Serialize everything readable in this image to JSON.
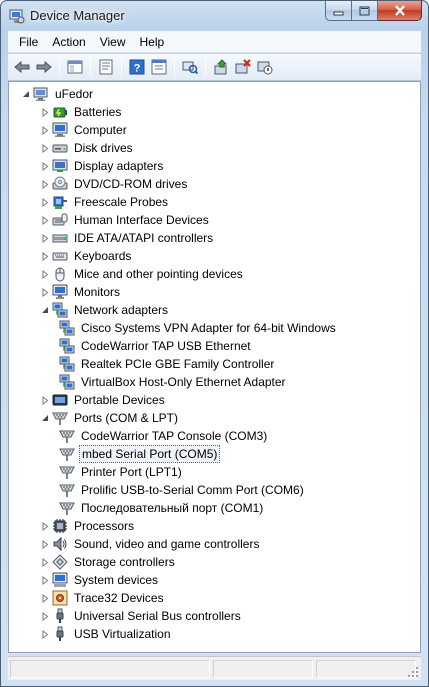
{
  "window": {
    "title": "Device Manager"
  },
  "menubar": {
    "items": [
      {
        "label": "File"
      },
      {
        "label": "Action"
      },
      {
        "label": "View"
      },
      {
        "label": "Help"
      }
    ]
  },
  "toolbar": {
    "buttons": [
      "back-icon",
      "forward-icon",
      "sep",
      "show-hide-console-tree-icon",
      "sep",
      "properties-icon",
      "sep",
      "help-icon",
      "properties-sheet-icon",
      "sep",
      "scan-hardware-icon",
      "sep",
      "update-driver-icon",
      "uninstall-icon",
      "disable-icon"
    ]
  },
  "tree": {
    "root": "uFedor",
    "nodes": [
      {
        "label": "Batteries",
        "level": 1,
        "expanded": false,
        "icon": "battery-icon"
      },
      {
        "label": "Computer",
        "level": 1,
        "expanded": false,
        "icon": "computer-icon"
      },
      {
        "label": "Disk drives",
        "level": 1,
        "expanded": false,
        "icon": "disk-drive-icon"
      },
      {
        "label": "Display adapters",
        "level": 1,
        "expanded": false,
        "icon": "display-adapter-icon"
      },
      {
        "label": "DVD/CD-ROM drives",
        "level": 1,
        "expanded": false,
        "icon": "dvd-drive-icon"
      },
      {
        "label": "Freescale Probes",
        "level": 1,
        "expanded": false,
        "icon": "probe-icon"
      },
      {
        "label": "Human Interface Devices",
        "level": 1,
        "expanded": false,
        "icon": "hid-icon"
      },
      {
        "label": "IDE ATA/ATAPI controllers",
        "level": 1,
        "expanded": false,
        "icon": "ide-controller-icon"
      },
      {
        "label": "Keyboards",
        "level": 1,
        "expanded": false,
        "icon": "keyboard-icon"
      },
      {
        "label": "Mice and other pointing devices",
        "level": 1,
        "expanded": false,
        "icon": "mouse-icon"
      },
      {
        "label": "Monitors",
        "level": 1,
        "expanded": false,
        "icon": "monitor-icon"
      },
      {
        "label": "Network adapters",
        "level": 1,
        "expanded": true,
        "icon": "network-adapter-icon"
      },
      {
        "label": "Cisco Systems VPN Adapter for 64-bit Windows",
        "level": 2,
        "icon": "network-adapter-icon"
      },
      {
        "label": "CodeWarrior TAP USB Ethernet",
        "level": 2,
        "icon": "network-adapter-icon"
      },
      {
        "label": "Realtek PCIe GBE Family Controller",
        "level": 2,
        "icon": "network-adapter-icon"
      },
      {
        "label": "VirtualBox Host-Only Ethernet Adapter",
        "level": 2,
        "icon": "network-adapter-icon"
      },
      {
        "label": "Portable Devices",
        "level": 1,
        "expanded": false,
        "icon": "portable-device-icon"
      },
      {
        "label": "Ports (COM & LPT)",
        "level": 1,
        "expanded": true,
        "icon": "port-icon"
      },
      {
        "label": "CodeWarrior TAP Console (COM3)",
        "level": 2,
        "icon": "port-icon"
      },
      {
        "label": "mbed Serial Port (COM5)",
        "level": 2,
        "icon": "port-icon",
        "selected": true
      },
      {
        "label": "Printer Port (LPT1)",
        "level": 2,
        "icon": "port-icon"
      },
      {
        "label": "Prolific USB-to-Serial Comm Port (COM6)",
        "level": 2,
        "icon": "port-icon"
      },
      {
        "label": "Последовательный порт (COM1)",
        "level": 2,
        "icon": "port-icon"
      },
      {
        "label": "Processors",
        "level": 1,
        "expanded": false,
        "icon": "processor-icon"
      },
      {
        "label": "Sound, video and game controllers",
        "level": 1,
        "expanded": false,
        "icon": "speaker-icon"
      },
      {
        "label": "Storage controllers",
        "level": 1,
        "expanded": false,
        "icon": "storage-controller-icon"
      },
      {
        "label": "System devices",
        "level": 1,
        "expanded": false,
        "icon": "system-device-icon"
      },
      {
        "label": "Trace32 Devices",
        "level": 1,
        "expanded": false,
        "icon": "trace32-icon"
      },
      {
        "label": "Universal Serial Bus controllers",
        "level": 1,
        "expanded": false,
        "icon": "usb-icon"
      },
      {
        "label": "USB Virtualization",
        "level": 1,
        "expanded": false,
        "icon": "usb-icon"
      }
    ]
  }
}
